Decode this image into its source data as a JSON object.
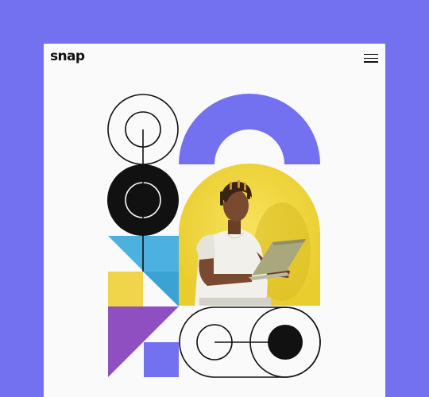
{
  "header": {
    "logo_text": "snap",
    "menu_icon": "hamburger-menu-icon"
  },
  "hero": {
    "photo": "person-with-laptop-photo",
    "colors": {
      "page_background": "#7371F0",
      "card_background": "#FAFAFA",
      "violet": "#7371F0",
      "black": "#111111",
      "sky_blue": "#4CB1DE",
      "yellow": "#F0D54A",
      "purple": "#8E50C0"
    }
  }
}
